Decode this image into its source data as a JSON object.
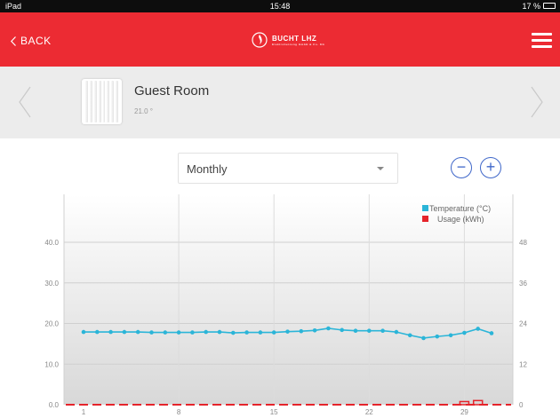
{
  "status_bar": {
    "device": "iPad",
    "time": "15:48",
    "battery": "17 %"
  },
  "nav": {
    "back_label": "BACK",
    "logo_name": "BUCHT LHZ",
    "logo_subtitle": "Elektroheizung GmbH & Co. KG"
  },
  "room": {
    "name": "Guest Room",
    "temperature": "21.0 °"
  },
  "period_select": {
    "value": "Monthly"
  },
  "zoom": {
    "minus": "−",
    "plus": "+"
  },
  "colors": {
    "accent": "#ec2b33",
    "temperature": "#2bb5d8",
    "usage": "#e5242b",
    "button": "#3f67c9"
  },
  "chart_data": {
    "type": "line",
    "x_ticks": [
      "1",
      "8",
      "15",
      "22",
      "29"
    ],
    "y_left_ticks": [
      "0.0",
      "10.0",
      "20.0",
      "30.0",
      "40.0"
    ],
    "y_right_ticks": [
      "0",
      "12",
      "24",
      "36",
      "48"
    ],
    "ylim_left": [
      0,
      40
    ],
    "ylim_right": [
      0,
      48
    ],
    "xlim": [
      1,
      31
    ],
    "grid": true,
    "legend_position": "top-right",
    "series": [
      {
        "name": "Temperature (°C)",
        "axis": "left",
        "color": "#2bb5d8",
        "x": [
          1,
          2,
          3,
          4,
          5,
          6,
          7,
          8,
          9,
          10,
          11,
          12,
          13,
          14,
          15,
          16,
          17,
          18,
          19,
          20,
          21,
          22,
          23,
          24,
          25,
          26,
          27,
          28,
          29,
          30,
          31
        ],
        "values": [
          17.9,
          17.9,
          17.9,
          17.9,
          17.9,
          17.8,
          17.8,
          17.8,
          17.8,
          17.9,
          17.9,
          17.7,
          17.8,
          17.8,
          17.8,
          18.0,
          18.1,
          18.3,
          18.8,
          18.4,
          18.2,
          18.2,
          18.2,
          17.9,
          17.1,
          16.4,
          16.8,
          17.1,
          17.7,
          18.7,
          17.6
        ]
      },
      {
        "name": "Usage (kWh)",
        "axis": "right",
        "color": "#e5242b",
        "x": [
          1,
          2,
          3,
          4,
          5,
          6,
          7,
          8,
          9,
          10,
          11,
          12,
          13,
          14,
          15,
          16,
          17,
          18,
          19,
          20,
          21,
          22,
          23,
          24,
          25,
          26,
          27,
          28,
          29,
          30,
          31
        ],
        "values": [
          0,
          0,
          0,
          0,
          0,
          0,
          0,
          0,
          0,
          0,
          0,
          0,
          0,
          0,
          0,
          0,
          0,
          0,
          0,
          0,
          0,
          0,
          0,
          0,
          0,
          0,
          0,
          0,
          0.4,
          0.7,
          0
        ]
      }
    ]
  }
}
